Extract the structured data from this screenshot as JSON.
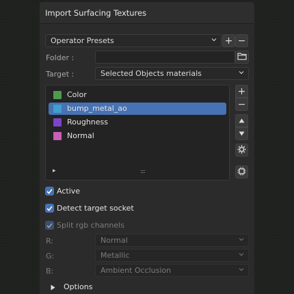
{
  "panel": {
    "title": "Import Surfacing Textures"
  },
  "presets": {
    "label": "Operator Presets",
    "add": "+",
    "remove": "−"
  },
  "folder": {
    "label": "Folder :",
    "value": ""
  },
  "target": {
    "label": "Target :",
    "value": "Selected Objects materials"
  },
  "texture_list": {
    "items": [
      {
        "name": "Color",
        "color": "#4f9a4f",
        "selected": false
      },
      {
        "name": "bump_metal_ao",
        "color": "#3f9fd0",
        "selected": true
      },
      {
        "name": "Roughness",
        "color": "#7e44c8",
        "selected": false
      },
      {
        "name": "Normal",
        "color": "#c95fb6",
        "selected": false
      }
    ],
    "expand_glyph": "▸",
    "resize_glyph": "::::",
    "side_buttons": {
      "add": "+",
      "remove": "−"
    }
  },
  "options": {
    "active": {
      "label": "Active",
      "checked": true
    },
    "detect_socket": {
      "label": "Detect target socket",
      "checked": true
    },
    "split_rgb": {
      "label": "Split rgb channels",
      "checked": true
    }
  },
  "channels": {
    "r": {
      "label": "R:",
      "value": "Normal"
    },
    "g": {
      "label": "G:",
      "value": "Metallic"
    },
    "b": {
      "label": "B:",
      "value": "Ambient Occlusion"
    }
  },
  "options_section": {
    "label": "Options"
  },
  "colors": {
    "accent": "#4772b3",
    "panel": "#2b2b2b"
  }
}
